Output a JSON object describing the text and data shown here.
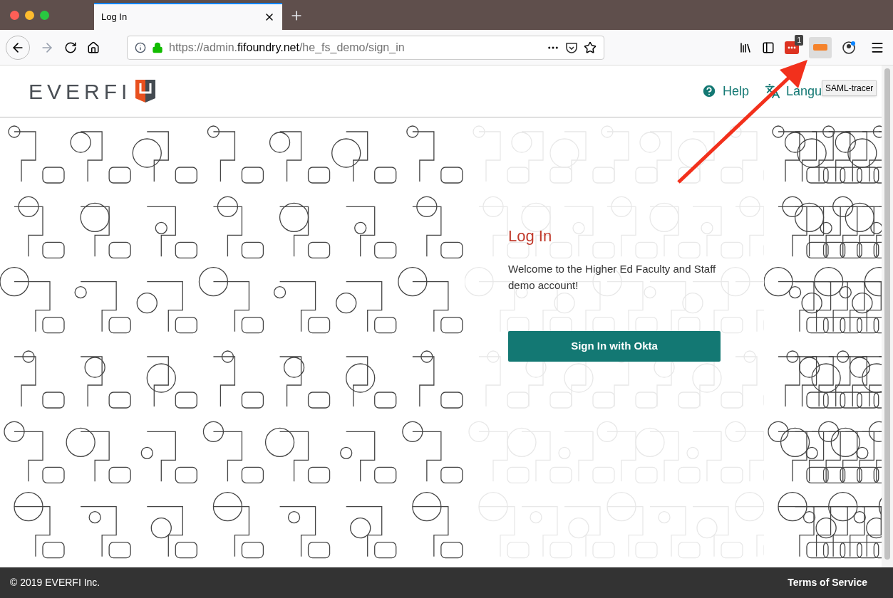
{
  "browser": {
    "tab": {
      "title": "Log In",
      "selected": true
    },
    "address": {
      "url_prefix": "https://admin.",
      "url_domain": "fifoundry.net",
      "url_path": "/he_fs_demo/sign_in"
    },
    "extension_badge": "1",
    "tooltip": "SAML-tracer"
  },
  "header": {
    "logo_text": "EVERFI",
    "links": [
      {
        "kind": "help",
        "label": "Help"
      },
      {
        "kind": "language",
        "label": "Langu"
      }
    ]
  },
  "login": {
    "title": "Log In",
    "message": "Welcome to the Higher Ed Faculty and Staff demo account!",
    "button": "Sign In with Okta"
  },
  "footer": {
    "copyright": "© 2019 EVERFI Inc.",
    "terms": "Terms of Service"
  }
}
